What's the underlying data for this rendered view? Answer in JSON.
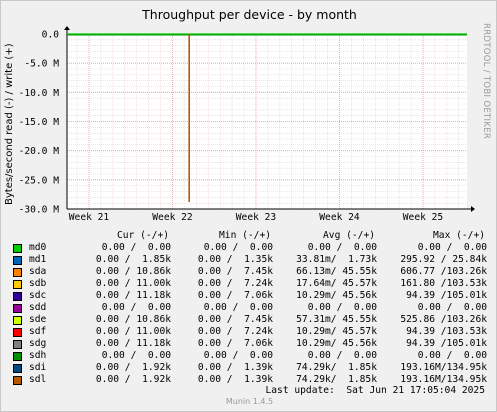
{
  "chart_data": {
    "type": "line",
    "title": "Throughput per device - by month",
    "ylabel": "Bytes/second read (-) / write (+)",
    "ylim": [
      -30000000,
      0
    ],
    "y_ticks": [
      {
        "value": 0,
        "label": "0.0"
      },
      {
        "value": -5000000,
        "label": "-5.0 M"
      },
      {
        "value": -10000000,
        "label": "-10.0 M"
      },
      {
        "value": -15000000,
        "label": "-15.0 M"
      },
      {
        "value": -20000000,
        "label": "-20.0 M"
      },
      {
        "value": -25000000,
        "label": "-25.0 M"
      },
      {
        "value": -30000000,
        "label": "-30.0 M"
      }
    ],
    "x_ticks": [
      "Week 21",
      "Week 22",
      "Week 23",
      "Week 24",
      "Week 25"
    ],
    "grid": true,
    "spike": {
      "series": "sdl",
      "x_week": 22.2,
      "value": -28800000
    },
    "watermark": "RRDTOOL / TOBI OETIKER",
    "columns": [
      "Cur (-/+)",
      "Min (-/+)",
      "Avg (-/+)",
      "Max (-/+)"
    ],
    "series": [
      {
        "name": "md0",
        "color": "#00cc00",
        "cur": "0.00 /  0.00",
        "min": "0.00 /  0.00",
        "avg": "0.00 /  0.00",
        "max": "0.00 /  0.00"
      },
      {
        "name": "md1",
        "color": "#0066b3",
        "cur": "0.00 /  1.85k",
        "min": "0.00 /  1.35k",
        "avg": "33.81m/  1.73k",
        "max": "295.92 / 25.84k"
      },
      {
        "name": "sda",
        "color": "#ff8000",
        "cur": "0.00 / 10.86k",
        "min": "0.00 /  7.45k",
        "avg": "66.13m/ 45.55k",
        "max": "606.77 /103.26k"
      },
      {
        "name": "sdb",
        "color": "#ffcc00",
        "cur": "0.00 / 11.00k",
        "min": "0.00 /  7.24k",
        "avg": "17.64m/ 45.57k",
        "max": "161.80 /103.53k"
      },
      {
        "name": "sdc",
        "color": "#330099",
        "cur": "0.00 / 11.18k",
        "min": "0.00 /  7.06k",
        "avg": "10.29m/ 45.56k",
        "max": "94.39 /105.01k"
      },
      {
        "name": "sdd",
        "color": "#990099",
        "cur": "0.00 /  0.00",
        "min": "0.00 /  0.00",
        "avg": "0.00 /  0.00",
        "max": "0.00 /  0.00"
      },
      {
        "name": "sde",
        "color": "#ccff00",
        "cur": "0.00 / 10.86k",
        "min": "0.00 /  7.45k",
        "avg": "57.31m/ 45.55k",
        "max": "525.86 /103.26k"
      },
      {
        "name": "sdf",
        "color": "#ff0000",
        "cur": "0.00 / 11.00k",
        "min": "0.00 /  7.24k",
        "avg": "10.29m/ 45.57k",
        "max": "94.39 /103.53k"
      },
      {
        "name": "sdg",
        "color": "#808080",
        "cur": "0.00 / 11.18k",
        "min": "0.00 /  7.06k",
        "avg": "10.29m/ 45.56k",
        "max": "94.39 /105.01k"
      },
      {
        "name": "sdh",
        "color": "#008f00",
        "cur": "0.00 /  0.00",
        "min": "0.00 /  0.00",
        "avg": "0.00 /  0.00",
        "max": "0.00 /  0.00"
      },
      {
        "name": "sdi",
        "color": "#00487d",
        "cur": "0.00 /  1.92k",
        "min": "0.00 /  1.39k",
        "avg": "74.29k/  1.85k",
        "max": "193.16M/134.95k"
      },
      {
        "name": "sdl",
        "color": "#b35a00",
        "cur": "0.00 /  1.92k",
        "min": "0.00 /  1.39k",
        "avg": "74.29k/  1.85k",
        "max": "193.16M/134.95k"
      }
    ],
    "last_update": "Last update:  Sat Jun 21 17:05:04 2025",
    "footer": "Munin 1.4.5"
  }
}
